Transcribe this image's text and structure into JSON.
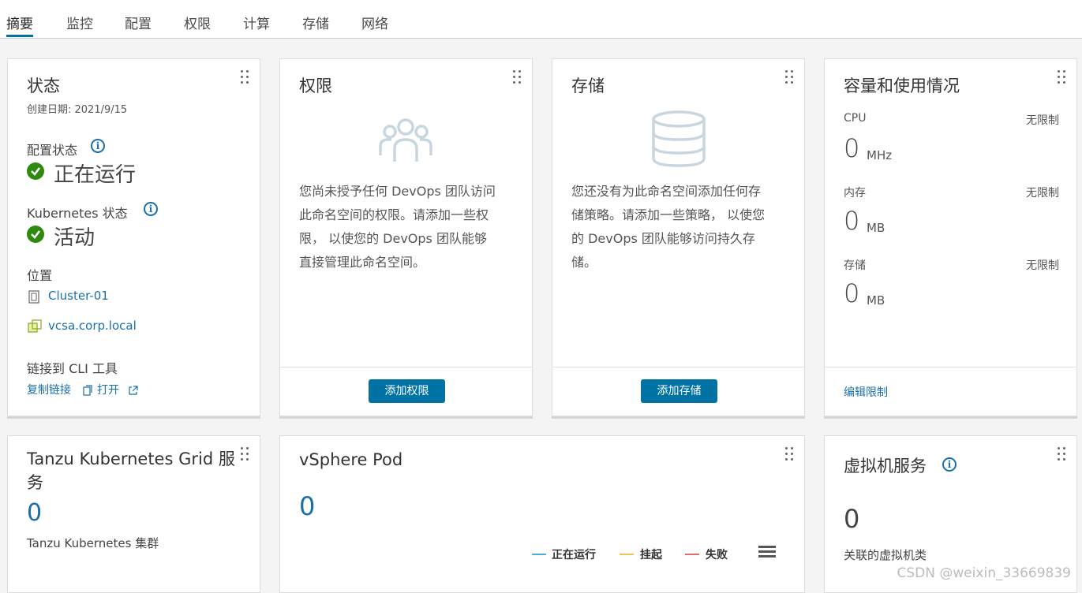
{
  "tabs": [
    "摘要",
    "监控",
    "配置",
    "权限",
    "计算",
    "存储",
    "网络"
  ],
  "status_card": {
    "title": "状态",
    "created": "创建日期: 2021/9/15",
    "config_label": "配置状态",
    "config_value": "正在运行",
    "k8s_label": "Kubernetes 状态",
    "k8s_value": "活动",
    "location_label": "位置",
    "cluster": "Cluster-01",
    "vcsa": "vcsa.corp.local",
    "cli_label": "链接到 CLI 工具",
    "copy_link": "复制链接",
    "open": "打开"
  },
  "perm_card": {
    "title": "权限",
    "desc_lines": [
      "您尚未授予任何 DevOps 团队访问",
      "此命名空间的权限。请添加一些权",
      "限， 以使您的 DevOps 团队能够",
      "直接管理此命名空间。"
    ],
    "button": "添加权限"
  },
  "storage_card": {
    "title": "存储",
    "desc_lines": [
      "您还没有为此命名空间添加任何存",
      "储策略。请添加一些策略， 以使您",
      "的 DevOps 团队能够访问持久存",
      "储。"
    ],
    "button": "添加存储"
  },
  "capacity_card": {
    "title": "容量和使用情况",
    "rows": [
      {
        "label": "CPU",
        "limit": "无限制",
        "value": "0",
        "unit": "MHz"
      },
      {
        "label": "内存",
        "limit": "无限制",
        "value": "0",
        "unit": "MB"
      },
      {
        "label": "存储",
        "limit": "无限制",
        "value": "0",
        "unit": "MB"
      }
    ],
    "edit": "编辑限制"
  },
  "tkg_card": {
    "title_1": "Tanzu Kubernetes Grid 服",
    "title_2": "务",
    "value": "0",
    "sub": "Tanzu Kubernetes 集群"
  },
  "pod_card": {
    "title": "vSphere Pod",
    "value": "0",
    "legend": [
      {
        "label": "正在运行",
        "color": "#49afd9"
      },
      {
        "label": "挂起",
        "color": "#f2c94c"
      },
      {
        "label": "失败",
        "color": "#e06c6c"
      }
    ]
  },
  "vm_card": {
    "title": "虚拟机服务",
    "value": "0",
    "sub": "关联的虚拟机类"
  },
  "watermark": "CSDN @weixin_33669839",
  "colors": {
    "accent": "#0072a3",
    "link": "#1b6fa8",
    "ok": "#2e8a0f"
  }
}
